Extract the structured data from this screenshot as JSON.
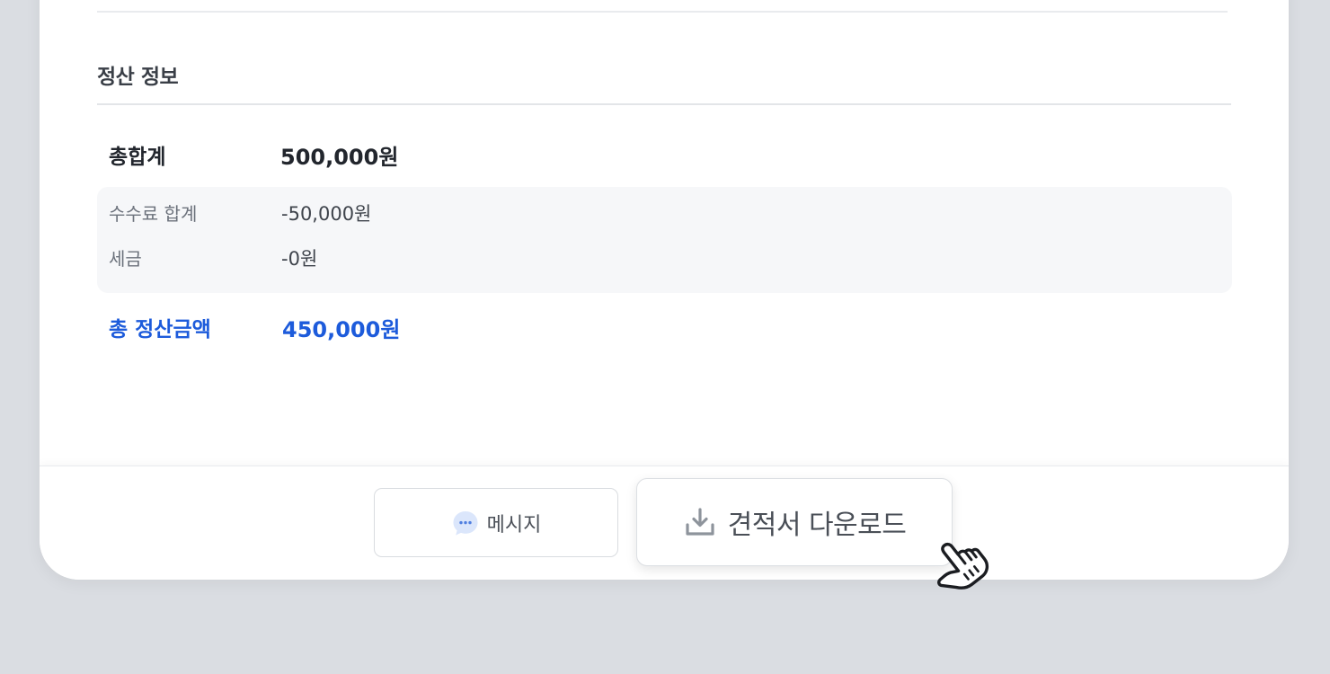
{
  "settlement": {
    "section_title": "정산 정보",
    "total": {
      "label": "총합계",
      "value": "500,000원"
    },
    "fee": {
      "label": "수수료 합계",
      "value": "-50,000원"
    },
    "tax": {
      "label": "세금",
      "value": "-0원"
    },
    "final": {
      "label": "총 정산금액",
      "value": "450,000원"
    }
  },
  "footer": {
    "message_button": {
      "label": "메시지",
      "icon": "chat-bubble-icon"
    },
    "download_button": {
      "label": "견적서 다운로드",
      "icon": "download-icon"
    }
  },
  "colors": {
    "accent": "#1d5bdb",
    "page_background": "#dadde2",
    "card_background": "#ffffff",
    "deduction_background": "#f6f7f9"
  }
}
